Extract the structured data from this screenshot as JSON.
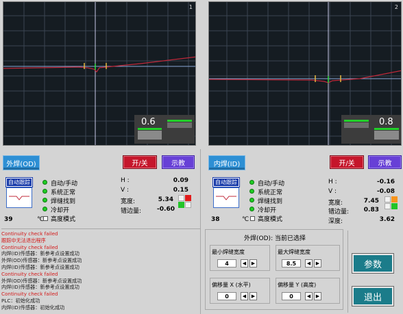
{
  "left": {
    "scope_number": "1",
    "readout_value": "0.6",
    "weld_button": "外焊(OD)",
    "onoff_button": "开/关",
    "teach_button": "示教",
    "track_label": "自动跟踪",
    "status": [
      "自动/手动",
      "系统正常",
      "焊缝找到",
      "冷却开"
    ],
    "high_mode": "高度模式",
    "temp_value": "39",
    "temp_unit": "℃",
    "metrics": [
      {
        "label": "H :",
        "value": "0.09"
      },
      {
        "label": "V :",
        "value": "0.15"
      },
      {
        "label": "宽度:",
        "value": "5.34"
      },
      {
        "label": "错边量:",
        "value": "-0.60"
      }
    ]
  },
  "right": {
    "scope_number": "2",
    "readout_value": "0.8",
    "weld_button": "内焊(ID)",
    "onoff_button": "开/关",
    "teach_button": "示教",
    "track_label": "自动跟踪",
    "status": [
      "自动/手动",
      "系统正常",
      "焊缝找到",
      "冷却开"
    ],
    "high_mode": "高度模式",
    "temp_value": "38",
    "temp_unit": "℃",
    "metrics": [
      {
        "label": "H :",
        "value": "-0.16"
      },
      {
        "label": "V :",
        "value": "-0.08"
      },
      {
        "label": "宽度:",
        "value": "7.45"
      },
      {
        "label": "错边量:",
        "value": "0.83"
      },
      {
        "label": "深度:",
        "value": "3.62"
      }
    ]
  },
  "log": [
    {
      "text": "Continuity check failed",
      "color": "red"
    },
    {
      "text": "跟踪中无法退出程序",
      "color": "red"
    },
    {
      "text": "Continuity check failed",
      "color": "red"
    },
    {
      "text": "内焊(ID)传感器：新参考点设置成功",
      "color": "black"
    },
    {
      "text": "外焊(OD)传感器：新参考点设置成功",
      "color": "black"
    },
    {
      "text": "内焊(ID)传感器：新参考点设置成功",
      "color": "black"
    },
    {
      "text": "Continuity check failed",
      "color": "red"
    },
    {
      "text": "外焊(OD)传感器：新参考点设置成功",
      "color": "black"
    },
    {
      "text": "内焊(ID)传感器：新参考点设置成功",
      "color": "black"
    },
    {
      "text": "Continuity check failed",
      "color": "red"
    },
    {
      "text": "PLC：初始化成功",
      "color": "black"
    },
    {
      "text": "内焊(ID)传感器：初始化成功",
      "color": "black"
    }
  ],
  "params": {
    "title": "外焊(OD): 当前已选择",
    "min_width_label": "最小焊缝宽度",
    "min_width_value": "4",
    "max_width_label": "最大焊缝宽度",
    "max_width_value": "8.5",
    "offset_x_label": "偏移量 X (水平)",
    "offset_x_value": "0",
    "offset_y_label": "偏移量 Y (高度)",
    "offset_y_value": "0",
    "left_arrow": "◀",
    "right_arrow": "▶"
  },
  "side": {
    "params_button": "参数",
    "exit_button": "退出"
  },
  "colors": {
    "scope_bg": "#151c22",
    "trace": "#c0283a",
    "led_green": "#1fcc24"
  }
}
